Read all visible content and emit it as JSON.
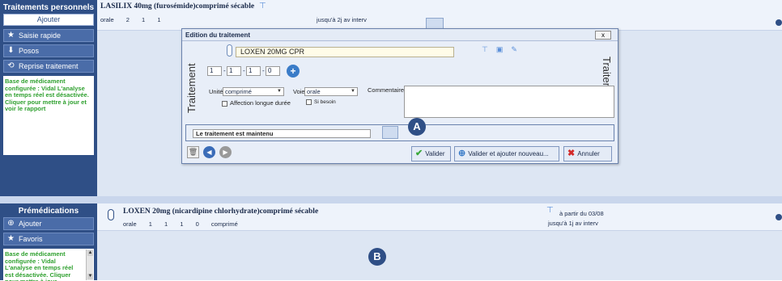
{
  "top_section": {
    "header": "Traitements personnels",
    "add_button": "Ajouter",
    "items": [
      {
        "label": "Saisie rapide",
        "icon": "star-icon"
      },
      {
        "label": "Posos",
        "icon": "download-icon"
      },
      {
        "label": "Reprise traitement",
        "icon": "reset-icon"
      }
    ],
    "note": "Base de médicament configurée : Vidal L'analyse en temps réel est désactivée. Cliquer pour mettre à jour et voir le rapport"
  },
  "top_row": {
    "drug": "LASILIX 40mg (furosémide)comprimé sécable",
    "route": "orale",
    "doses": [
      "2",
      "1",
      "1"
    ],
    "extra": "0",
    "timing": "jusqu'à 2j av interv"
  },
  "dialog": {
    "title": "Edition du traitement",
    "close": "x",
    "side_label": "Traitement",
    "medication": "LOXEN 20MG CPR",
    "doses": [
      "1",
      "1",
      "1",
      "0"
    ],
    "unit_label": "Unité",
    "unit_value": "comprimé",
    "route_label": "Voie",
    "route_value": "orale",
    "comment_label": "Commentaire",
    "check_affection": "Affection longue durée",
    "check_besoin": "Si besoin",
    "status": "Le traitement est maintenu",
    "btn_validate": "Valider",
    "btn_validate_new": "Valider et ajouter nouveau...",
    "btn_cancel": "Annuler"
  },
  "bottom_section": {
    "header": "Prémédications",
    "add_button": "Ajouter",
    "favorites": "Favoris",
    "note": "Base de médicament configurée : Vidal L'analyse en temps réel est désactivée. Cliquer pour mettre à jour"
  },
  "bottom_row": {
    "drug": "LOXEN 20mg (nicardipine chlorhydrate)comprimé sécable",
    "route": "orale",
    "doses": [
      "1",
      "1",
      "1",
      "0"
    ],
    "unit": "comprimé",
    "start": "à partir du 03/08",
    "until": "jusqu'à 1j av interv"
  },
  "markers": {
    "a": "A",
    "b": "B"
  },
  "colors": {
    "sidebar": "#2f4f86",
    "note_text": "#2fa02f",
    "panel": "#dde6f3"
  }
}
